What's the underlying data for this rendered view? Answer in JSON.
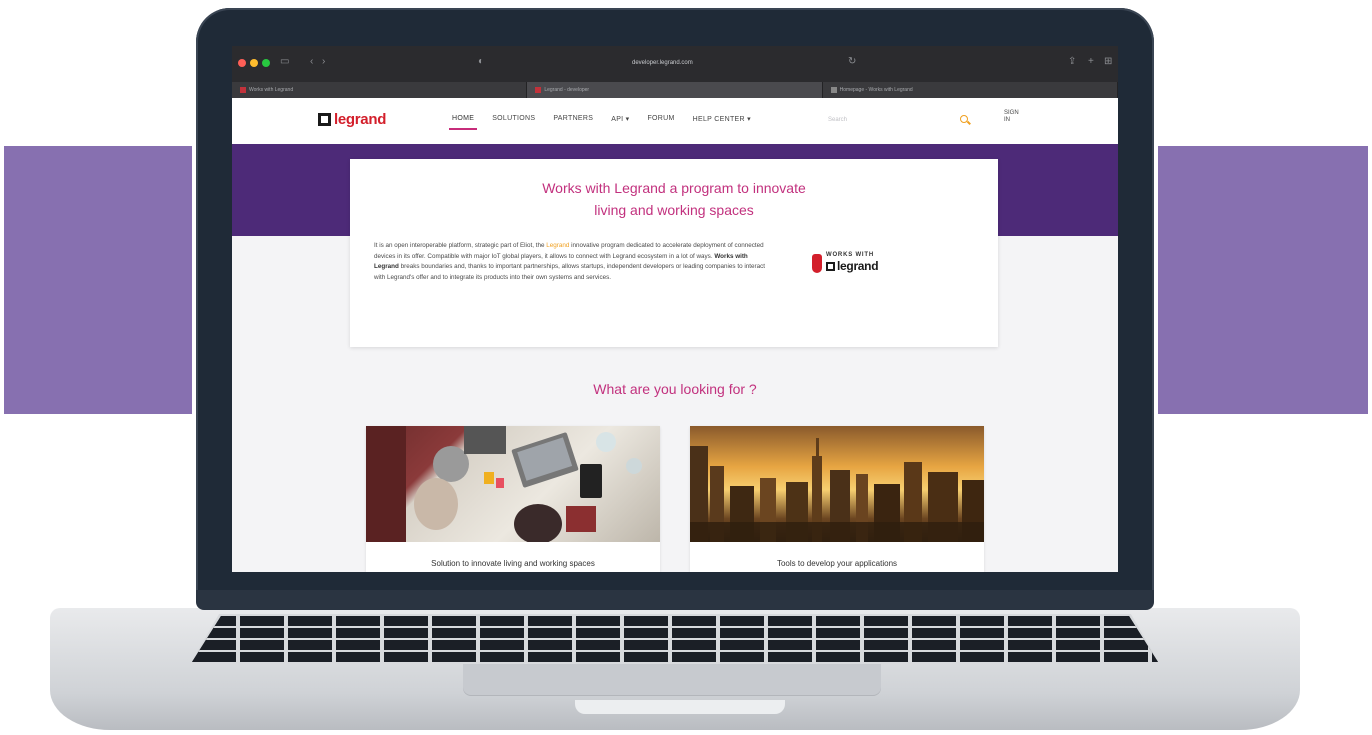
{
  "browser": {
    "url": "developer.legrand.com",
    "tabs": [
      {
        "label": "Works with Legrand",
        "active": false
      },
      {
        "label": "Legrand - developer",
        "active": true
      },
      {
        "label": "Homepage - Works with Legrand",
        "active": false
      }
    ]
  },
  "navbar": {
    "logo_text": "legrand",
    "items": [
      {
        "label": "HOME",
        "active": true
      },
      {
        "label": "SOLUTIONS",
        "active": false
      },
      {
        "label": "PARTNERS",
        "active": false
      },
      {
        "label": "API ▾",
        "active": false
      },
      {
        "label": "FORUM",
        "active": false
      },
      {
        "label": "HELP CENTER ▾",
        "active": false
      }
    ],
    "search_placeholder": "Search",
    "signin_label": "SIGN IN"
  },
  "intro": {
    "title_line1": "Works with Legrand a program to innovate",
    "title_line2": "living and working spaces",
    "body_part1": "It is an open interoperable platform, strategic part of Eliot, the ",
    "body_highlight": "Legrand",
    "body_part2": " innovative program dedicated to accelerate deployment of connected devices in its offer. Compatible with major IoT global players, it allows to connect with Legrand ecosystem in a lot of ways. ",
    "body_bold": "Works with Legrand",
    "body_part3": " breaks boundaries and, thanks to important partnerships, allows startups, independent developers or leading companies to interact with Legrand's offer and to integrate its products into their own systems and services.",
    "badge_top": "WORKS WITH",
    "badge_brand": "legrand"
  },
  "looking_for": {
    "title": "What are you looking for ?",
    "cards": [
      {
        "caption": "Solution to innovate living and working spaces"
      },
      {
        "caption": "Tools to develop your applications"
      }
    ]
  },
  "colors": {
    "band": "#8770b0",
    "hero": "#4d2a78",
    "accent": "#c2317e",
    "brand_red": "#d31f2b",
    "highlight": "#f0a020"
  }
}
